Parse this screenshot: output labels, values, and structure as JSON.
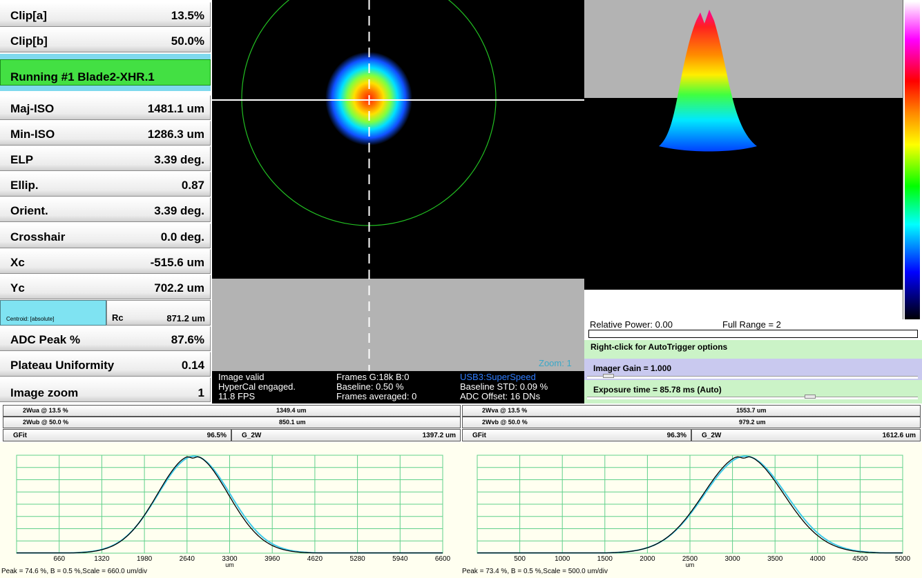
{
  "params_top": [
    {
      "label": "Clip[a]",
      "value": "13.5%"
    },
    {
      "label": "Clip[b]",
      "value": "50.0%"
    }
  ],
  "status_running": "Running #1 Blade2-XHR.1",
  "params": [
    {
      "label": "Maj-ISO",
      "value": "1481.1 um"
    },
    {
      "label": "Min-ISO",
      "value": "1286.3 um"
    },
    {
      "label": "ELP",
      "value": "3.39 deg."
    },
    {
      "label": "Ellip.",
      "value": "0.87"
    },
    {
      "label": "Orient.",
      "value": "3.39 deg."
    },
    {
      "label": "Crosshair",
      "value": "0.0 deg."
    },
    {
      "label": "Xc",
      "value": "-515.6 um"
    },
    {
      "label": "Yc",
      "value": "702.2 um"
    }
  ],
  "centroid": {
    "label": "Centroid: [absolute]",
    "rc_label": "Rc",
    "rc_value": "871.2 um"
  },
  "params_bottom": [
    {
      "label": "ADC Peak %",
      "value": "87.6%"
    },
    {
      "label": "Plateau Uniformity",
      "value": "0.14"
    },
    {
      "label": "Image zoom",
      "value": "1"
    }
  ],
  "view2d": {
    "zoom_label": "Zoom: 1",
    "status_col1": [
      "Image valid",
      "HyperCal engaged.",
      "11.8 FPS"
    ],
    "status_col2": [
      "Frames G:18k B:0",
      "Baseline: 0.50 %",
      "Frames averaged: 0"
    ],
    "status_col3": [
      "USB3:SuperSpeed",
      "Baseline STD:  0.09 %",
      "ADC Offset: 16 DNs"
    ]
  },
  "controls": {
    "relative_power": "Relative Power: 0.00",
    "full_range": "Full Range = 2",
    "autotrigger": "Right-click for AutoTrigger options",
    "gain": "Imager Gain = 1.000",
    "exposure": "Exposure time = 85.78 ms (Auto)",
    "gain_level": 0.05,
    "exposure_level": 0.68
  },
  "widths": {
    "left": [
      {
        "label": "2Wua @ 13.5 %",
        "value": "1349.4 um"
      },
      {
        "label": "2Wub @ 50.0 %",
        "value": "850.1 um"
      }
    ],
    "right": [
      {
        "label": "2Wva @ 13.5 %",
        "value": "1553.7 um"
      },
      {
        "label": "2Wvb @ 50.0 %",
        "value": "979.2 um"
      }
    ],
    "left_gfit": {
      "label": "GFit",
      "value": "96.5%",
      "g2w_label": "G_2W",
      "g2w_value": "1397.2 um"
    },
    "right_gfit": {
      "label": "GFit",
      "value": "96.3%",
      "g2w_label": "G_2W",
      "g2w_value": "1612.6 um"
    }
  },
  "colors": {
    "plot_bg": "#fffff0",
    "grid": "#5fd08a",
    "fit_curve": "#3fc8e8",
    "profile_curve": "#000000"
  },
  "chart_data": [
    {
      "type": "line",
      "xlabel": "um",
      "x_ticks": [
        "660",
        "1320",
        "1980",
        "2640",
        "3300",
        "3960",
        "4620",
        "5280",
        "5940",
        "6600"
      ],
      "xlim": [
        0,
        6600
      ],
      "ylim": [
        0,
        100
      ],
      "caption": "Peak = 74.6 %, B = 0.5 %,Scale = 660.0 um/div",
      "series": [
        {
          "kind": "gaussian-fit",
          "center": 2750,
          "sigma": 560,
          "peak": 99
        },
        {
          "kind": "measured",
          "center": 2730,
          "sigma": 545,
          "peak": 100
        }
      ]
    },
    {
      "type": "line",
      "xlabel": "um",
      "x_ticks": [
        "500",
        "1000",
        "1500",
        "2000",
        "2500",
        "3000",
        "3500",
        "4000",
        "4500",
        "5000"
      ],
      "xlim": [
        0,
        5000
      ],
      "ylim": [
        0,
        100
      ],
      "caption": "Peak = 73.4 %, B = 0.5 %,Scale = 500.0 um/div",
      "series": [
        {
          "kind": "gaussian-fit",
          "center": 3150,
          "sigma": 480,
          "peak": 99
        },
        {
          "kind": "measured",
          "center": 3130,
          "sigma": 470,
          "peak": 100
        }
      ]
    }
  ]
}
